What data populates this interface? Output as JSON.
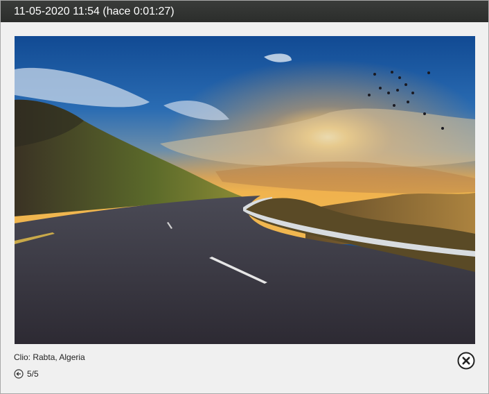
{
  "dialog": {
    "title": "11-05-2020 11:54 (hace 0:01:27)",
    "caption": "Clio: Rabta, Algeria",
    "counter": "5/5"
  },
  "icons": {
    "back": "arrow-left-circle-icon",
    "close": "close-circle-icon"
  },
  "colors": {
    "titlebar": "#2f312f",
    "panel": "#f0f0f0",
    "text": "#222222"
  }
}
